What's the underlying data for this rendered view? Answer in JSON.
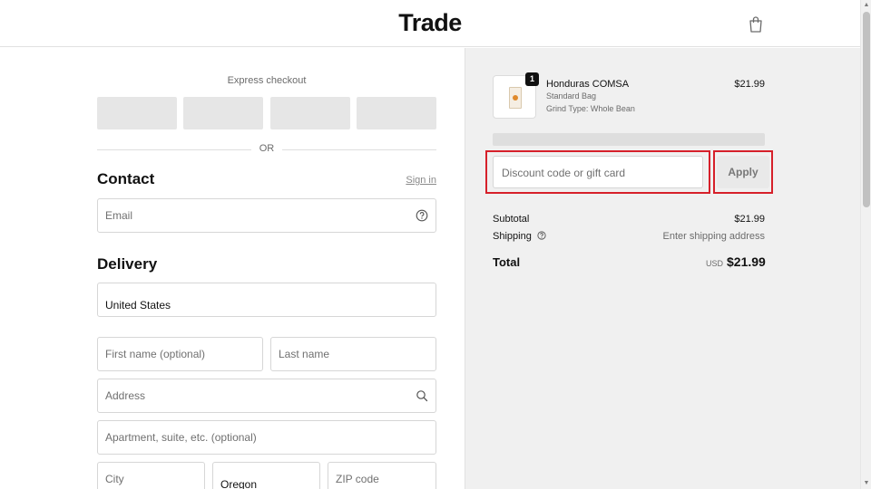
{
  "header": {
    "logo": "Trade",
    "cart_icon": "shopping-bag-icon"
  },
  "express": {
    "title": "Express checkout",
    "buttons": [
      "",
      "",
      "",
      ""
    ],
    "divider_text": "OR"
  },
  "contact": {
    "title": "Contact",
    "signin_label": "Sign in",
    "email_placeholder": "Email",
    "email_help_icon": "help-circle-icon"
  },
  "delivery": {
    "title": "Delivery",
    "country_value": "United States",
    "first_name_placeholder": "First name (optional)",
    "last_name_placeholder": "Last name",
    "address_placeholder": "Address",
    "address_icon": "search-icon",
    "apartment_placeholder": "Apartment, suite, etc. (optional)",
    "city_placeholder": "City",
    "state_value": "Oregon",
    "zip_placeholder": "ZIP code"
  },
  "order": {
    "item": {
      "quantity": "1",
      "name": "Honduras COMSA",
      "variant": "Standard Bag",
      "grind": "Grind Type: Whole Bean",
      "price": "$21.99"
    },
    "discount_placeholder": "Discount code or gift card",
    "apply_label": "Apply",
    "subtotal_label": "Subtotal",
    "subtotal_value": "$21.99",
    "shipping_label": "Shipping",
    "shipping_value": "Enter shipping address",
    "total_label": "Total",
    "total_currency": "USD",
    "total_value": "$21.99"
  },
  "colors": {
    "highlight": "#d6202a",
    "summary_bg": "#f0f0f0"
  }
}
